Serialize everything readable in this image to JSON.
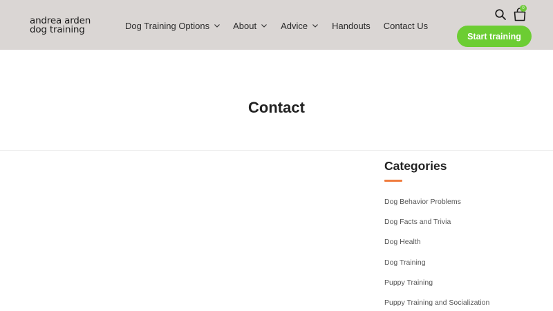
{
  "header": {
    "logo_line1": "andrea arden",
    "logo_line2": "dog training",
    "nav": [
      {
        "label": "Dog Training Options",
        "dropdown": true
      },
      {
        "label": "About",
        "dropdown": true
      },
      {
        "label": "Advice",
        "dropdown": true
      },
      {
        "label": "Handouts",
        "dropdown": false
      },
      {
        "label": "Contact Us",
        "dropdown": false
      }
    ],
    "cart_count": "0",
    "cta_label": "Start training",
    "icons": [
      "search-icon",
      "shopping-bag-icon",
      "chevron-down-icon"
    ]
  },
  "page": {
    "title": "Contact"
  },
  "sidebar": {
    "categories_title": "Categories",
    "categories": [
      "Dog Behavior Problems",
      "Dog Facts and Trivia",
      "Dog Health",
      "Dog Training",
      "Puppy Training",
      "Puppy Training and Socialization"
    ]
  },
  "colors": {
    "header_bg": "#dad6d4",
    "cta_green": "#6ccd33",
    "accent_orange": "#f07c3e",
    "text_dark": "#222222"
  }
}
